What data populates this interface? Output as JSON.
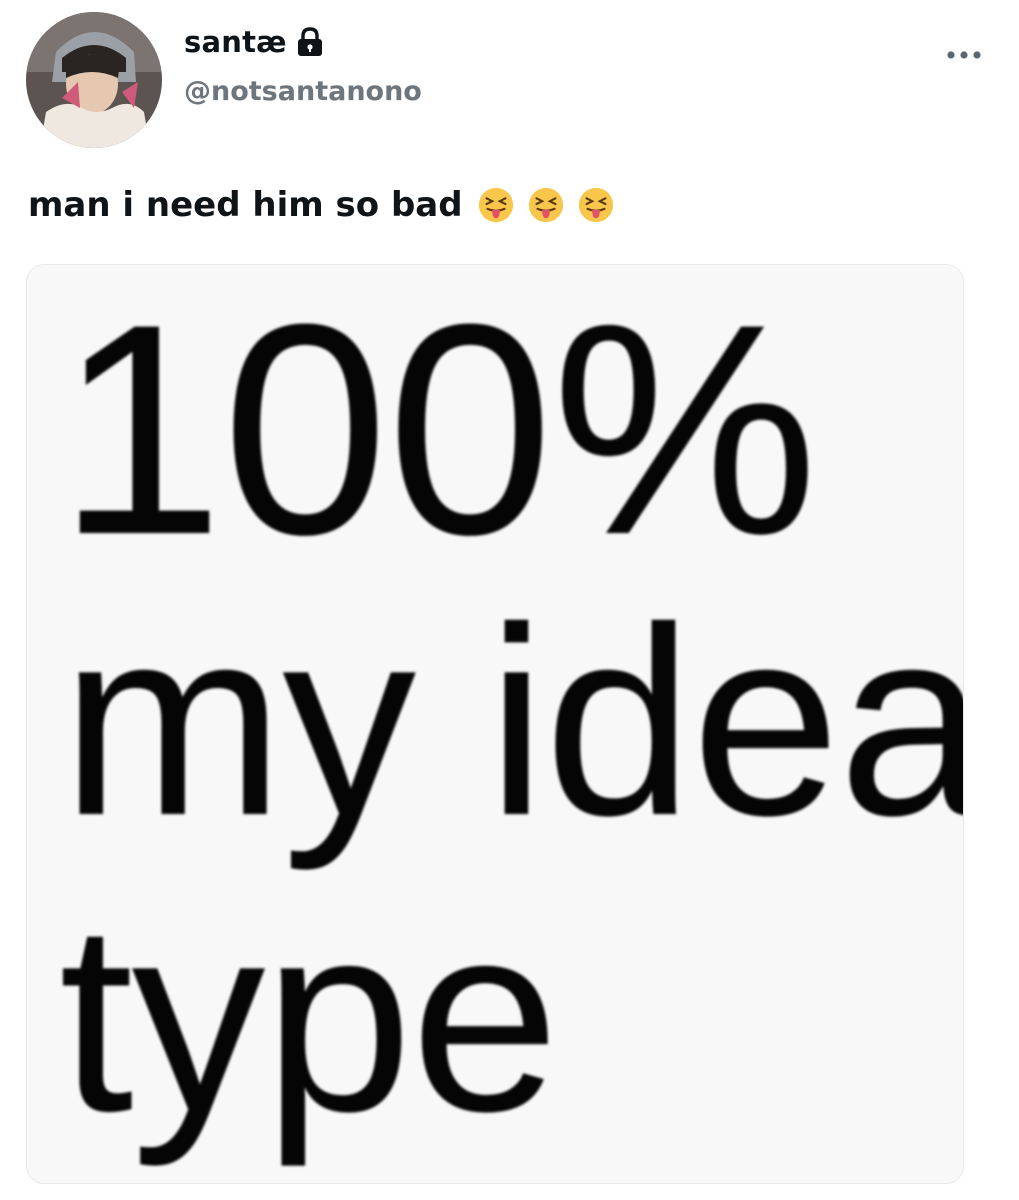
{
  "author": {
    "display_name": "santæ",
    "handle": "@notsantanono",
    "protected": true,
    "avatar_icon": "user-avatar",
    "lock_icon": "lock-icon"
  },
  "menu": {
    "more_icon": "more-horizontal-icon"
  },
  "tweet": {
    "text": "man i need him so bad",
    "emojis": [
      "😝",
      "😝",
      "😝"
    ]
  },
  "media": {
    "meme_lines": [
      "100%",
      "my ideal",
      "type"
    ]
  },
  "colors": {
    "text_primary": "#0f1419",
    "text_secondary": "#6e767d",
    "media_background": "#f8f8f8"
  }
}
